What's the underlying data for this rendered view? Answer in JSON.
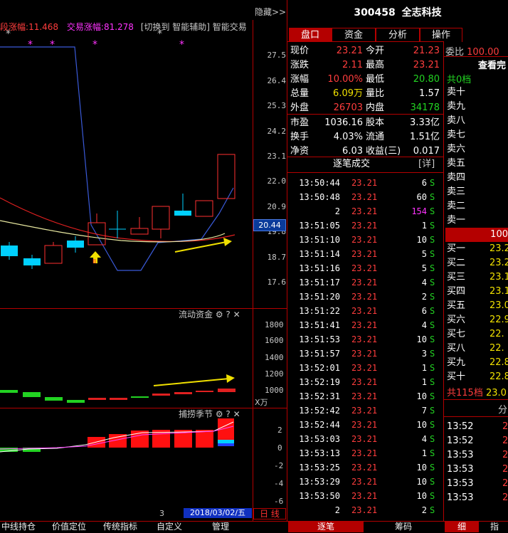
{
  "header": {
    "hide_label": "隐藏>>",
    "stock_code": "300458",
    "stock_name": "全志科技",
    "bar_label1": "涨幅:",
    "bar_value1": "11.468",
    "bar_label1_prefix": "段",
    "bar_label2": "交易涨幅:",
    "bar_value2": "81.278",
    "switch_label": "[切换到 智能辅助]",
    "smart_trade": "智能交易"
  },
  "tabs": [
    "盘口",
    "资金",
    "分析",
    "操作"
  ],
  "quote": {
    "rows": [
      {
        "l1": "现价",
        "v1": "23.21",
        "c1": "red",
        "l2": "今开",
        "v2": "21.23",
        "c2": "red"
      },
      {
        "l1": "涨跌",
        "v1": "2.11",
        "c1": "red",
        "l2": "最高",
        "v2": "23.21",
        "c2": "red"
      },
      {
        "l1": "涨幅",
        "v1": "10.00%",
        "c1": "red",
        "l2": "最低",
        "v2": "20.80",
        "c2": "grn"
      },
      {
        "l1": "总量",
        "v1": "6.09万",
        "c1": "yel",
        "l2": "量比",
        "v2": "1.57",
        "c2": "wht"
      },
      {
        "l1": "外盘",
        "v1": "26703",
        "c1": "red",
        "l2": "内盘",
        "v2": "34178",
        "c2": "grn"
      },
      {
        "l1": "市盈",
        "v1": "1036.16",
        "c1": "wht",
        "l2": "股本",
        "v2": "3.33亿",
        "c2": "wht"
      },
      {
        "l1": "换手",
        "v1": "4.03%",
        "c1": "wht",
        "l2": "流通",
        "v2": "1.51亿",
        "c2": "wht"
      },
      {
        "l1": "净资",
        "v1": "6.03",
        "c1": "wht",
        "l2": "收益(三)",
        "v2": "0.017",
        "c2": "wht"
      }
    ]
  },
  "trades": {
    "title": "逐笔成交",
    "detail": "[详]",
    "rows": [
      {
        "t": "13:50:44",
        "p": "23.21",
        "v": "6",
        "s": "S",
        "vc": "wht"
      },
      {
        "t": "13:50:48",
        "p": "23.21",
        "v": "60",
        "s": "S",
        "vc": "wht"
      },
      {
        "t": "2",
        "p": "23.21",
        "v": "154",
        "s": "S",
        "vc": "mag"
      },
      {
        "t": "13:51:05",
        "p": "23.21",
        "v": "1",
        "s": "S",
        "vc": "wht"
      },
      {
        "t": "13:51:10",
        "p": "23.21",
        "v": "10",
        "s": "S",
        "vc": "wht"
      },
      {
        "t": "13:51:14",
        "p": "23.21",
        "v": "5",
        "s": "S",
        "vc": "wht"
      },
      {
        "t": "13:51:16",
        "p": "23.21",
        "v": "5",
        "s": "S",
        "vc": "wht"
      },
      {
        "t": "13:51:17",
        "p": "23.21",
        "v": "4",
        "s": "S",
        "vc": "wht"
      },
      {
        "t": "13:51:20",
        "p": "23.21",
        "v": "2",
        "s": "S",
        "vc": "wht"
      },
      {
        "t": "13:51:22",
        "p": "23.21",
        "v": "6",
        "s": "S",
        "vc": "wht"
      },
      {
        "t": "13:51:41",
        "p": "23.21",
        "v": "4",
        "s": "S",
        "vc": "wht"
      },
      {
        "t": "13:51:53",
        "p": "23.21",
        "v": "10",
        "s": "S",
        "vc": "wht"
      },
      {
        "t": "13:51:57",
        "p": "23.21",
        "v": "3",
        "s": "S",
        "vc": "wht"
      },
      {
        "t": "13:52:01",
        "p": "23.21",
        "v": "1",
        "s": "S",
        "vc": "wht"
      },
      {
        "t": "13:52:19",
        "p": "23.21",
        "v": "1",
        "s": "S",
        "vc": "wht"
      },
      {
        "t": "13:52:31",
        "p": "23.21",
        "v": "10",
        "s": "S",
        "vc": "wht"
      },
      {
        "t": "13:52:42",
        "p": "23.21",
        "v": "7",
        "s": "S",
        "vc": "wht"
      },
      {
        "t": "13:52:44",
        "p": "23.21",
        "v": "10",
        "s": "S",
        "vc": "wht"
      },
      {
        "t": "13:53:03",
        "p": "23.21",
        "v": "4",
        "s": "S",
        "vc": "wht"
      },
      {
        "t": "13:53:13",
        "p": "23.21",
        "v": "1",
        "s": "S",
        "vc": "wht"
      },
      {
        "t": "13:53:25",
        "p": "23.21",
        "v": "10",
        "s": "S",
        "vc": "wht"
      },
      {
        "t": "13:53:29",
        "p": "23.21",
        "v": "10",
        "s": "S",
        "vc": "wht"
      },
      {
        "t": "13:53:50",
        "p": "23.21",
        "v": "10",
        "s": "S",
        "vc": "wht"
      },
      {
        "t": "2",
        "p": "23.21",
        "v": "2",
        "s": "S",
        "vc": "wht"
      }
    ]
  },
  "orderbook": {
    "weibi_label": "委比",
    "weibi_value": "100.00",
    "view_label": "查看完",
    "total_ask": "共0档",
    "asks": [
      "卖十",
      "卖九",
      "卖八",
      "卖七",
      "卖六",
      "卖五",
      "卖四",
      "卖三",
      "卖二",
      "卖一"
    ],
    "mid_value": "100",
    "bids": [
      {
        "l": "买一",
        "v": "23.2"
      },
      {
        "l": "买二",
        "v": "23.2"
      },
      {
        "l": "买三",
        "v": "23.1"
      },
      {
        "l": "买四",
        "v": "23.1"
      },
      {
        "l": "买五",
        "v": "23.0"
      },
      {
        "l": "买六",
        "v": "22.9"
      },
      {
        "l": "买七",
        "v": "22."
      },
      {
        "l": "买八",
        "v": "22."
      },
      {
        "l": "买九",
        "v": "22.8"
      },
      {
        "l": "买十",
        "v": "22.8"
      }
    ],
    "total_bid": "共115档",
    "total_bid_value": "23.0",
    "subtab_label": "分",
    "ticks": [
      {
        "t": "13:52",
        "v": "2"
      },
      {
        "t": "13:52",
        "v": "2"
      },
      {
        "t": "13:53",
        "v": "2"
      },
      {
        "t": "13:53",
        "v": "2"
      },
      {
        "t": "13:53",
        "v": "2"
      },
      {
        "t": "13:53",
        "v": "2"
      }
    ]
  },
  "chart": {
    "price_ticks": [
      "27.5",
      "26.4",
      "25.3",
      "24.2",
      "23.1",
      "22.0",
      "20.9",
      "19.8",
      "18.7",
      "17.6"
    ],
    "price_highlight": "20.44",
    "b_marker": "B",
    "flow_title": "流动资金",
    "flow_ticks": [
      "1800",
      "1600",
      "1400",
      "1200",
      "1000"
    ],
    "flow_unit": "X万",
    "season_title": "捕捞季节",
    "season_ticks": [
      "2",
      "0",
      "-2",
      "-4",
      "-6"
    ],
    "star_white": "*",
    "star_magenta": "*",
    "date_label": "2018/03/02/五",
    "num_label": "3",
    "period_label": "日 线",
    "tool_icons": "⚙ ? ✕"
  },
  "bottom": {
    "left_tabs": [
      "中线持仓",
      "价值定位",
      "传统指标",
      "自定义",
      "管理"
    ],
    "mid_tabs": [
      "逐笔",
      "筹码"
    ],
    "right_tabs": [
      "细",
      "指"
    ]
  }
}
